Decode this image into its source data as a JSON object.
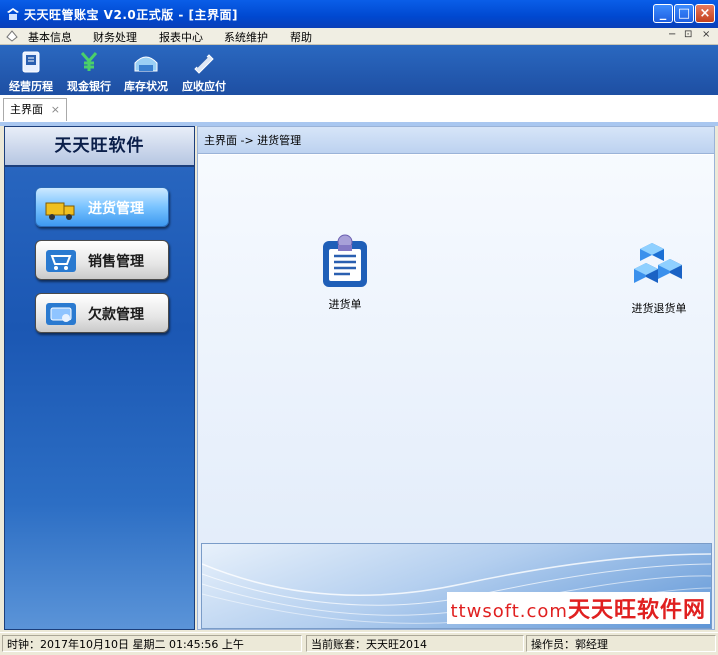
{
  "window": {
    "title": "天天旺管账宝 V2.0正式版 - [主界面]",
    "controls": [
      "minimize",
      "maximize",
      "close"
    ]
  },
  "menu": {
    "items": [
      "基本信息",
      "财务处理",
      "报表中心",
      "系统维护",
      "帮助"
    ],
    "mdi_controls": [
      "−",
      "⊡",
      "×"
    ]
  },
  "toolbar": {
    "buttons": [
      {
        "label": "经营历程",
        "icon": "book-icon"
      },
      {
        "label": "现金银行",
        "icon": "money-icon"
      },
      {
        "label": "库存状况",
        "icon": "warehouse-icon"
      },
      {
        "label": "应收应付",
        "icon": "invoice-icon"
      }
    ]
  },
  "tabs": [
    {
      "label": "主界面",
      "close": "×"
    }
  ],
  "sidebar": {
    "title": "天天旺软件",
    "items": [
      {
        "label": "进货管理",
        "icon": "truck-icon",
        "active": true
      },
      {
        "label": "销售管理",
        "icon": "cart-icon",
        "active": false
      },
      {
        "label": "欠款管理",
        "icon": "debt-icon",
        "active": false
      }
    ]
  },
  "main": {
    "breadcrumb": "主界面 -> 进货管理",
    "functions": [
      {
        "label": "进货单",
        "icon": "clipboard-icon"
      },
      {
        "label": "进货退货单",
        "icon": "boxes-icon"
      }
    ]
  },
  "watermark": {
    "domain": "ttwsoft.com",
    "text": "天天旺软件网"
  },
  "status": {
    "clock": "时钟：2017年10月10日 星期二 01:45:56 上午",
    "account": "当前账套：天天旺2014",
    "operator": "操作员：郭经理"
  },
  "colors": {
    "accent": "#1e4fa3",
    "title_bar": "#0a5ee8",
    "watermark": "#e02020"
  }
}
